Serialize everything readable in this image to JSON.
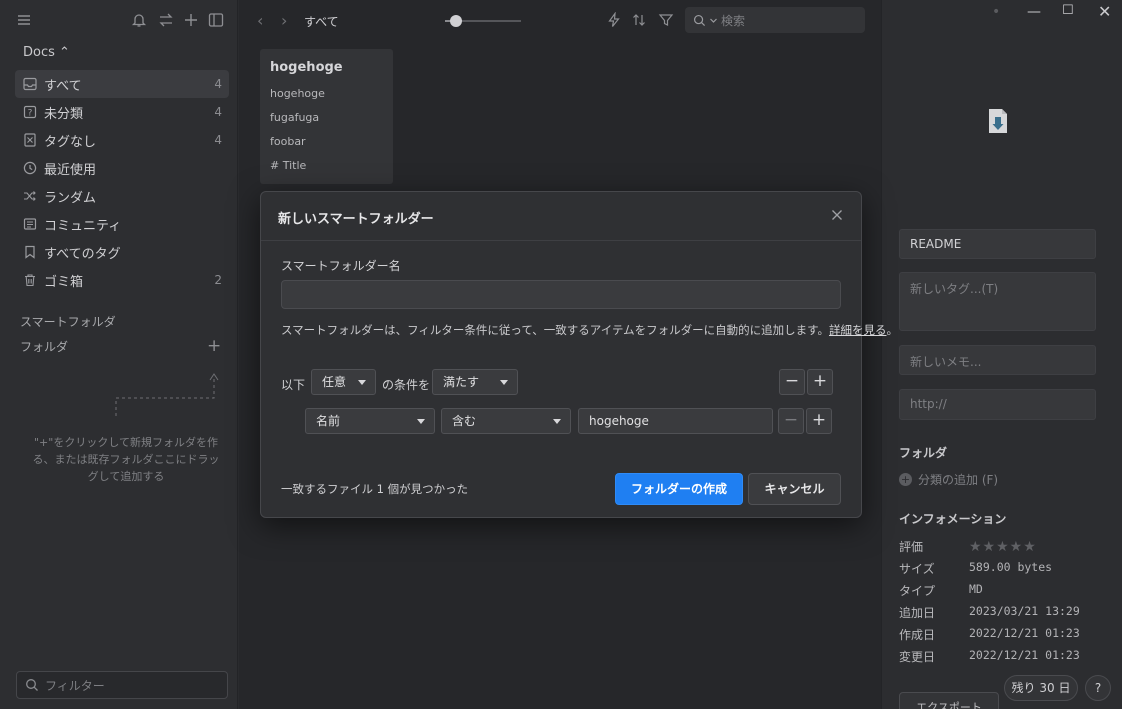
{
  "sidebar": {
    "library": "Docs ⌃",
    "nav": [
      {
        "label": "すべて",
        "count": "4",
        "icon": "inbox-icon"
      },
      {
        "label": "未分類",
        "count": "4",
        "icon": "question-box-icon"
      },
      {
        "label": "タグなし",
        "count": "4",
        "icon": "untagged-icon"
      },
      {
        "label": "最近使用",
        "count": "",
        "icon": "clock-icon"
      },
      {
        "label": "ランダム",
        "count": "",
        "icon": "shuffle-icon"
      },
      {
        "label": "コミュニティ",
        "count": "",
        "icon": "community-icon"
      },
      {
        "label": "すべてのタグ",
        "count": "",
        "icon": "bookmark-icon"
      },
      {
        "label": "ゴミ箱",
        "count": "2",
        "icon": "trash-icon"
      }
    ],
    "smart_folder_section": "スマートフォルダ",
    "folder_section": "フォルダ",
    "hint": "\"+\"をクリックして新規フォルダを作る、または既存フォルダここにドラッグして追加する",
    "filter_placeholder": "フィルター"
  },
  "toolbar": {
    "title": "すべて",
    "zoom_level": 0.15,
    "search_placeholder": "検索"
  },
  "card": {
    "title": "hogehoge",
    "lines": [
      "hogehoge",
      "fugafuga",
      "foobar",
      "# Title"
    ]
  },
  "dialog": {
    "title": "新しいスマートフォルダー",
    "name_label": "スマートフォルダー名",
    "name_value": "",
    "description": "スマートフォルダーは、フィルター条件に従って、一致するアイテムをフォルダーに自動的に追加します。",
    "learn_more": "詳細を見る",
    "description_end": "。",
    "cond_prefix": "以下",
    "match_mode": "任意",
    "cond_mid": "の条件を",
    "match_verb": "満たす",
    "rule": {
      "field": "名前",
      "operator": "含む",
      "value": "hogehoge"
    },
    "found_text": "一致するファイル 1 個が見つかった",
    "create_button": "フォルダーの作成",
    "cancel_button": "キャンセル"
  },
  "inspector": {
    "title_value": "README",
    "tags_placeholder": "新しいタグ...(T)",
    "memo_placeholder": "新しいメモ...",
    "url_placeholder": "http://",
    "folder_label": "フォルダ",
    "add_category": "分類の追加 (F)",
    "info_label": "インフォメーション",
    "rating_label": "評価",
    "rating": 0,
    "rows": [
      {
        "key": "サイズ",
        "value": "589.00 bytes"
      },
      {
        "key": "タイプ",
        "value": "MD"
      },
      {
        "key": "追加日",
        "value": "2023/03/21 13:29"
      },
      {
        "key": "作成日",
        "value": "2022/12/21 01:23"
      },
      {
        "key": "変更日",
        "value": "2022/12/21 01:23"
      }
    ],
    "trial_badge": "残り 30 日",
    "help": "?",
    "export_button": "エクスポート"
  }
}
